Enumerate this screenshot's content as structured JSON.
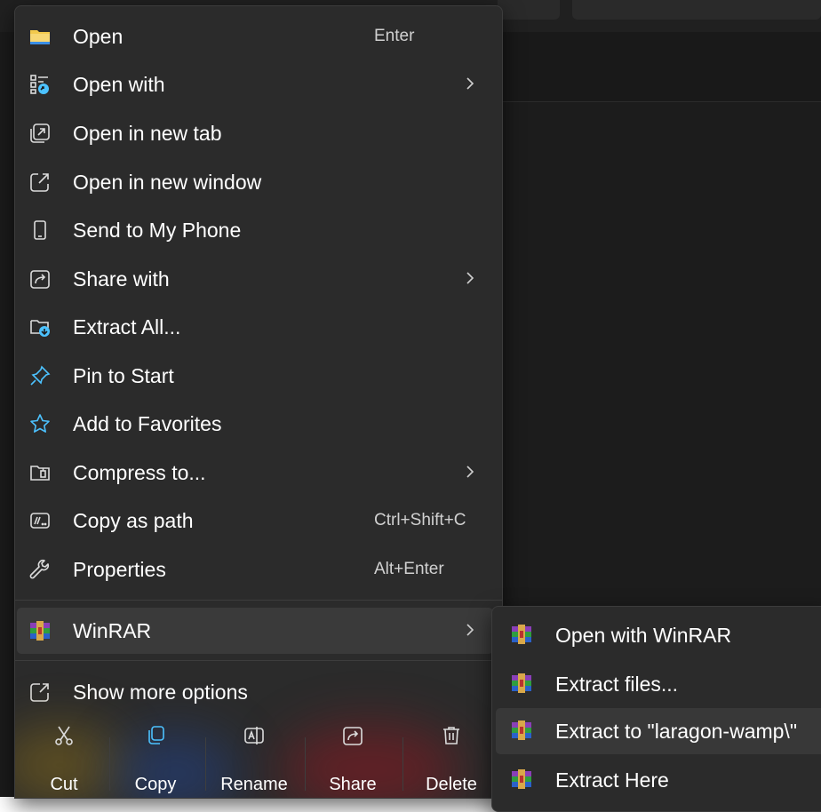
{
  "menu": {
    "items": [
      {
        "label": "Open",
        "shortcut": "Enter",
        "icon": "folder-icon"
      },
      {
        "label": "Open with",
        "shortcut": "",
        "icon": "open-with-icon",
        "submenu": true
      },
      {
        "label": "Open in new tab",
        "shortcut": "",
        "icon": "new-tab-icon"
      },
      {
        "label": "Open in new window",
        "shortcut": "",
        "icon": "new-window-icon"
      },
      {
        "label": "Send to My Phone",
        "shortcut": "",
        "icon": "phone-icon"
      },
      {
        "label": "Share with",
        "shortcut": "",
        "icon": "share-with-icon",
        "submenu": true
      },
      {
        "label": "Extract All...",
        "shortcut": "",
        "icon": "extract-folder-icon"
      },
      {
        "label": "Pin to Start",
        "shortcut": "",
        "icon": "pin-icon"
      },
      {
        "label": "Add to Favorites",
        "shortcut": "",
        "icon": "star-icon"
      },
      {
        "label": "Compress to...",
        "shortcut": "",
        "icon": "compress-icon",
        "submenu": true
      },
      {
        "label": "Copy as path",
        "shortcut": "Ctrl+Shift+C",
        "icon": "copy-path-icon"
      },
      {
        "label": "Properties",
        "shortcut": "Alt+Enter",
        "icon": "wrench-icon"
      },
      {
        "label": "WinRAR",
        "shortcut": "",
        "icon": "winrar-icon",
        "submenu": true,
        "active": true
      },
      {
        "label": "Show more options",
        "shortcut": "",
        "icon": "more-options-icon"
      }
    ]
  },
  "toolbar": {
    "buttons": [
      {
        "label": "Cut",
        "icon": "scissors-icon"
      },
      {
        "label": "Copy",
        "icon": "copy-icon"
      },
      {
        "label": "Rename",
        "icon": "rename-icon"
      },
      {
        "label": "Share",
        "icon": "share-icon"
      },
      {
        "label": "Delete",
        "icon": "trash-icon"
      }
    ]
  },
  "submenu": {
    "items": [
      {
        "label": "Open with WinRAR",
        "icon": "winrar-icon"
      },
      {
        "label": "Extract files...",
        "icon": "winrar-icon"
      },
      {
        "label": "Extract to \"laragon-wamp\\\"",
        "icon": "winrar-icon",
        "active": true
      },
      {
        "label": "Extract Here",
        "icon": "winrar-icon"
      }
    ]
  },
  "colors": {
    "menu_bg": "#2b2b2b",
    "accent_blue": "#4cc2ff",
    "folder_yellow": "#f2c94c",
    "text": "#ffffff"
  }
}
